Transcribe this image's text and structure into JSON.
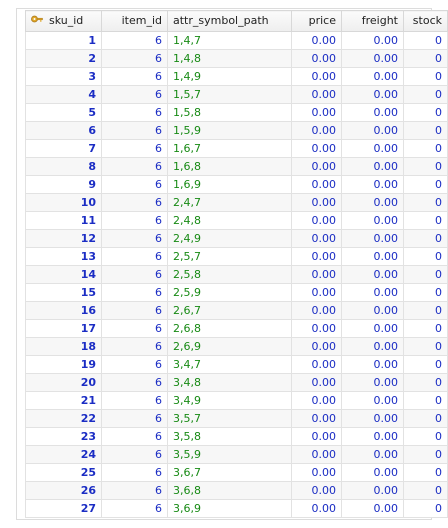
{
  "columns": [
    {
      "key": "sku_id",
      "label": "sku_id",
      "primary_key_icon": "key-icon"
    },
    {
      "key": "item_id",
      "label": "item_id"
    },
    {
      "key": "attr_symbol_path",
      "label": "attr_symbol_path"
    },
    {
      "key": "price",
      "label": "price"
    },
    {
      "key": "freight",
      "label": "freight"
    },
    {
      "key": "stock",
      "label": "stock"
    }
  ],
  "rows": [
    {
      "sku_id": "1",
      "item_id": "6",
      "attr_symbol_path": "1,4,7",
      "price": "0.00",
      "freight": "0.00",
      "stock": "0"
    },
    {
      "sku_id": "2",
      "item_id": "6",
      "attr_symbol_path": "1,4,8",
      "price": "0.00",
      "freight": "0.00",
      "stock": "0"
    },
    {
      "sku_id": "3",
      "item_id": "6",
      "attr_symbol_path": "1,4,9",
      "price": "0.00",
      "freight": "0.00",
      "stock": "0"
    },
    {
      "sku_id": "4",
      "item_id": "6",
      "attr_symbol_path": "1,5,7",
      "price": "0.00",
      "freight": "0.00",
      "stock": "0"
    },
    {
      "sku_id": "5",
      "item_id": "6",
      "attr_symbol_path": "1,5,8",
      "price": "0.00",
      "freight": "0.00",
      "stock": "0"
    },
    {
      "sku_id": "6",
      "item_id": "6",
      "attr_symbol_path": "1,5,9",
      "price": "0.00",
      "freight": "0.00",
      "stock": "0"
    },
    {
      "sku_id": "7",
      "item_id": "6",
      "attr_symbol_path": "1,6,7",
      "price": "0.00",
      "freight": "0.00",
      "stock": "0"
    },
    {
      "sku_id": "8",
      "item_id": "6",
      "attr_symbol_path": "1,6,8",
      "price": "0.00",
      "freight": "0.00",
      "stock": "0"
    },
    {
      "sku_id": "9",
      "item_id": "6",
      "attr_symbol_path": "1,6,9",
      "price": "0.00",
      "freight": "0.00",
      "stock": "0"
    },
    {
      "sku_id": "10",
      "item_id": "6",
      "attr_symbol_path": "2,4,7",
      "price": "0.00",
      "freight": "0.00",
      "stock": "0"
    },
    {
      "sku_id": "11",
      "item_id": "6",
      "attr_symbol_path": "2,4,8",
      "price": "0.00",
      "freight": "0.00",
      "stock": "0"
    },
    {
      "sku_id": "12",
      "item_id": "6",
      "attr_symbol_path": "2,4,9",
      "price": "0.00",
      "freight": "0.00",
      "stock": "0"
    },
    {
      "sku_id": "13",
      "item_id": "6",
      "attr_symbol_path": "2,5,7",
      "price": "0.00",
      "freight": "0.00",
      "stock": "0"
    },
    {
      "sku_id": "14",
      "item_id": "6",
      "attr_symbol_path": "2,5,8",
      "price": "0.00",
      "freight": "0.00",
      "stock": "0"
    },
    {
      "sku_id": "15",
      "item_id": "6",
      "attr_symbol_path": "2,5,9",
      "price": "0.00",
      "freight": "0.00",
      "stock": "0"
    },
    {
      "sku_id": "16",
      "item_id": "6",
      "attr_symbol_path": "2,6,7",
      "price": "0.00",
      "freight": "0.00",
      "stock": "0"
    },
    {
      "sku_id": "17",
      "item_id": "6",
      "attr_symbol_path": "2,6,8",
      "price": "0.00",
      "freight": "0.00",
      "stock": "0"
    },
    {
      "sku_id": "18",
      "item_id": "6",
      "attr_symbol_path": "2,6,9",
      "price": "0.00",
      "freight": "0.00",
      "stock": "0"
    },
    {
      "sku_id": "19",
      "item_id": "6",
      "attr_symbol_path": "3,4,7",
      "price": "0.00",
      "freight": "0.00",
      "stock": "0"
    },
    {
      "sku_id": "20",
      "item_id": "6",
      "attr_symbol_path": "3,4,8",
      "price": "0.00",
      "freight": "0.00",
      "stock": "0"
    },
    {
      "sku_id": "21",
      "item_id": "6",
      "attr_symbol_path": "3,4,9",
      "price": "0.00",
      "freight": "0.00",
      "stock": "0"
    },
    {
      "sku_id": "22",
      "item_id": "6",
      "attr_symbol_path": "3,5,7",
      "price": "0.00",
      "freight": "0.00",
      "stock": "0"
    },
    {
      "sku_id": "23",
      "item_id": "6",
      "attr_symbol_path": "3,5,8",
      "price": "0.00",
      "freight": "0.00",
      "stock": "0"
    },
    {
      "sku_id": "24",
      "item_id": "6",
      "attr_symbol_path": "3,5,9",
      "price": "0.00",
      "freight": "0.00",
      "stock": "0"
    },
    {
      "sku_id": "25",
      "item_id": "6",
      "attr_symbol_path": "3,6,7",
      "price": "0.00",
      "freight": "0.00",
      "stock": "0"
    },
    {
      "sku_id": "26",
      "item_id": "6",
      "attr_symbol_path": "3,6,8",
      "price": "0.00",
      "freight": "0.00",
      "stock": "0"
    },
    {
      "sku_id": "27",
      "item_id": "6",
      "attr_symbol_path": "3,6,9",
      "price": "0.00",
      "freight": "0.00",
      "stock": "0"
    }
  ],
  "colors": {
    "number_text": "#1b2dc4",
    "string_text": "#178a14",
    "key_icon": "#e0a82a"
  }
}
